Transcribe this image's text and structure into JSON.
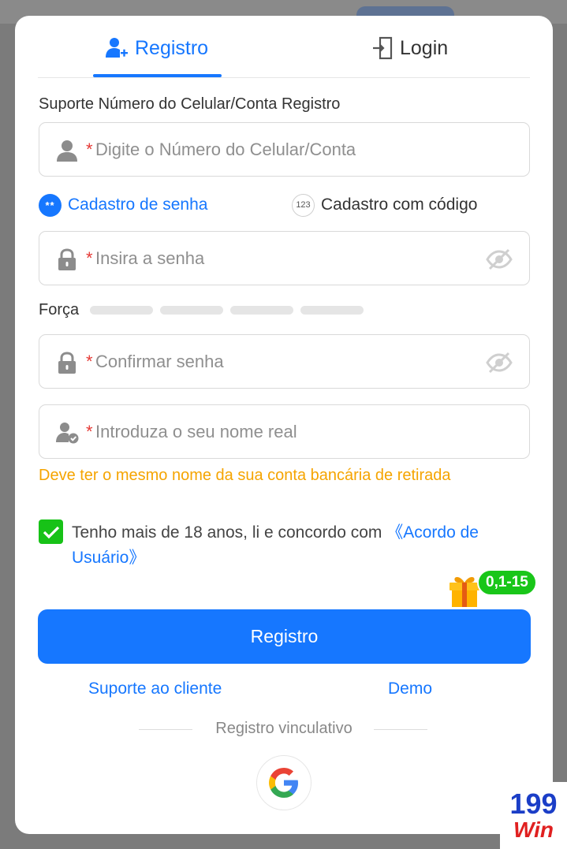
{
  "tabs": {
    "register": "Registro",
    "login": "Login"
  },
  "section_label": "Suporte Número do Celular/Conta Registro",
  "fields": {
    "required_mark": "*",
    "account_placeholder": "Digite o Número do Celular/Conta",
    "password_placeholder": "Insira a senha",
    "confirm_placeholder": "Confirmar senha",
    "realname_placeholder": "Introduza o seu nome real"
  },
  "modes": {
    "password": {
      "label": "Cadastro de senha",
      "icon_text": "**"
    },
    "code": {
      "label": "Cadastro com código",
      "icon_text": "123"
    }
  },
  "strength": {
    "label": "Força",
    "level": 0,
    "segments": 4
  },
  "name_warning": "Deve ter o mesmo nome da sua conta bancária de retirada",
  "agreement": {
    "checked": true,
    "text": "Tenho mais de 18 anos, li e concordo com ",
    "link": "《Acordo de Usuário》"
  },
  "gift_badge": "0,1-15",
  "register_button": "Registro",
  "links": {
    "support": "Suporte ao cliente",
    "demo": "Demo"
  },
  "divider_text": "Registro vinculativo",
  "brand": {
    "top": "199",
    "bottom": "Win"
  },
  "colors": {
    "accent": "#1677ff",
    "warning": "#f5a400",
    "check": "#17c217",
    "required": "#e53935"
  }
}
